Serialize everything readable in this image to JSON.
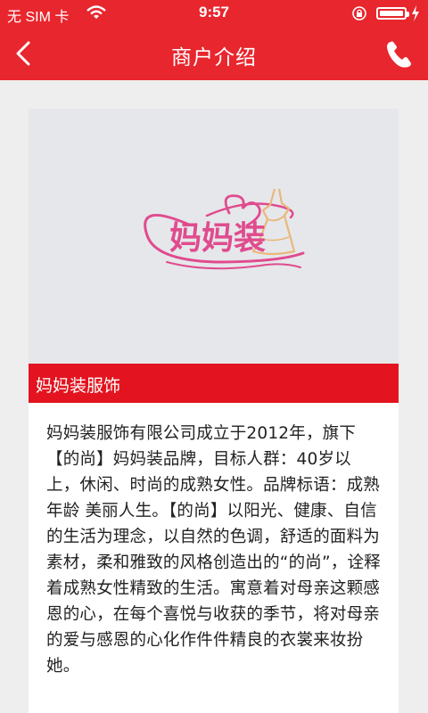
{
  "status_bar": {
    "carrier": "无 SIM 卡",
    "time": "9:57",
    "icons": [
      "wifi-icon",
      "orientation-lock-icon",
      "battery-icon",
      "charging-icon"
    ]
  },
  "nav": {
    "title": "商户介绍",
    "back_icon": "chevron-left-icon",
    "phone_icon": "phone-icon"
  },
  "banner": {
    "logo_text": "妈妈装"
  },
  "merchant": {
    "name": "妈妈装服饰",
    "description": "妈妈装服饰有限公司成立于2012年，旗下【的尚】妈妈装品牌，目标人群：40岁以上，休闲、时尚的成熟女性。品牌标语：成熟年龄 美丽人生。【的尚】以阳光、健康、自信的生活为理念，以自然的色调，舒适的面料为素材，柔和雅致的风格创造出的“的尚”，诠释着成熟女性精致的生活。寓意着对母亲这颗感恩的心，在每个喜悦与收获的季节，将对母亲的爱与感恩的心化作件件精良的衣裳来妆扮她。"
  },
  "colors": {
    "brand_red": "#e8262e",
    "logo_pink": "#e04b8e",
    "logo_gold": "#e9b87a"
  }
}
